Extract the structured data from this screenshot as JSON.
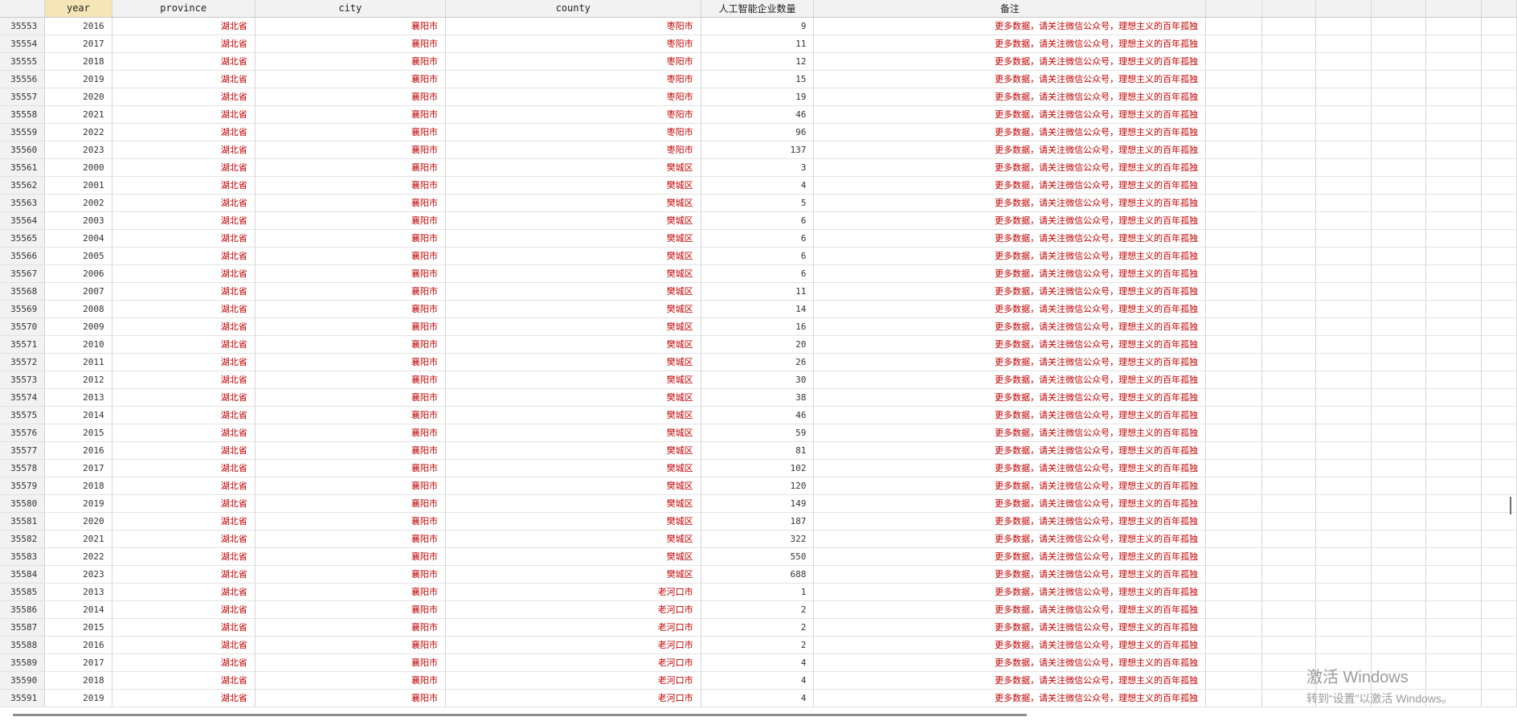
{
  "columns": [
    {
      "key": "rownum",
      "label": ""
    },
    {
      "key": "year",
      "label": "year",
      "selected": true
    },
    {
      "key": "province",
      "label": "province"
    },
    {
      "key": "city",
      "label": "city"
    },
    {
      "key": "county",
      "label": "county"
    },
    {
      "key": "ai_count",
      "label": "人工智能企业数量"
    },
    {
      "key": "note",
      "label": "备注"
    },
    {
      "key": "e1",
      "label": ""
    },
    {
      "key": "e2",
      "label": ""
    },
    {
      "key": "e3",
      "label": ""
    },
    {
      "key": "e4",
      "label": ""
    },
    {
      "key": "e5",
      "label": ""
    },
    {
      "key": "e6",
      "label": ""
    }
  ],
  "rows": [
    {
      "rownum": "35553",
      "year": "2016",
      "province": "湖北省",
      "city": "襄阳市",
      "county": "枣阳市",
      "ai_count": "9",
      "note": "更多数据，请关注微信公众号，理想主义的百年孤独"
    },
    {
      "rownum": "35554",
      "year": "2017",
      "province": "湖北省",
      "city": "襄阳市",
      "county": "枣阳市",
      "ai_count": "11",
      "note": "更多数据，请关注微信公众号，理想主义的百年孤独"
    },
    {
      "rownum": "35555",
      "year": "2018",
      "province": "湖北省",
      "city": "襄阳市",
      "county": "枣阳市",
      "ai_count": "12",
      "note": "更多数据，请关注微信公众号，理想主义的百年孤独"
    },
    {
      "rownum": "35556",
      "year": "2019",
      "province": "湖北省",
      "city": "襄阳市",
      "county": "枣阳市",
      "ai_count": "15",
      "note": "更多数据，请关注微信公众号，理想主义的百年孤独"
    },
    {
      "rownum": "35557",
      "year": "2020",
      "province": "湖北省",
      "city": "襄阳市",
      "county": "枣阳市",
      "ai_count": "19",
      "note": "更多数据，请关注微信公众号，理想主义的百年孤独"
    },
    {
      "rownum": "35558",
      "year": "2021",
      "province": "湖北省",
      "city": "襄阳市",
      "county": "枣阳市",
      "ai_count": "46",
      "note": "更多数据，请关注微信公众号，理想主义的百年孤独"
    },
    {
      "rownum": "35559",
      "year": "2022",
      "province": "湖北省",
      "city": "襄阳市",
      "county": "枣阳市",
      "ai_count": "96",
      "note": "更多数据，请关注微信公众号，理想主义的百年孤独"
    },
    {
      "rownum": "35560",
      "year": "2023",
      "province": "湖北省",
      "city": "襄阳市",
      "county": "枣阳市",
      "ai_count": "137",
      "note": "更多数据，请关注微信公众号，理想主义的百年孤独"
    },
    {
      "rownum": "35561",
      "year": "2000",
      "province": "湖北省",
      "city": "襄阳市",
      "county": "樊城区",
      "ai_count": "3",
      "note": "更多数据，请关注微信公众号，理想主义的百年孤独"
    },
    {
      "rownum": "35562",
      "year": "2001",
      "province": "湖北省",
      "city": "襄阳市",
      "county": "樊城区",
      "ai_count": "4",
      "note": "更多数据，请关注微信公众号，理想主义的百年孤独"
    },
    {
      "rownum": "35563",
      "year": "2002",
      "province": "湖北省",
      "city": "襄阳市",
      "county": "樊城区",
      "ai_count": "5",
      "note": "更多数据，请关注微信公众号，理想主义的百年孤独"
    },
    {
      "rownum": "35564",
      "year": "2003",
      "province": "湖北省",
      "city": "襄阳市",
      "county": "樊城区",
      "ai_count": "6",
      "note": "更多数据，请关注微信公众号，理想主义的百年孤独"
    },
    {
      "rownum": "35565",
      "year": "2004",
      "province": "湖北省",
      "city": "襄阳市",
      "county": "樊城区",
      "ai_count": "6",
      "note": "更多数据，请关注微信公众号，理想主义的百年孤独"
    },
    {
      "rownum": "35566",
      "year": "2005",
      "province": "湖北省",
      "city": "襄阳市",
      "county": "樊城区",
      "ai_count": "6",
      "note": "更多数据，请关注微信公众号，理想主义的百年孤独"
    },
    {
      "rownum": "35567",
      "year": "2006",
      "province": "湖北省",
      "city": "襄阳市",
      "county": "樊城区",
      "ai_count": "6",
      "note": "更多数据，请关注微信公众号，理想主义的百年孤独"
    },
    {
      "rownum": "35568",
      "year": "2007",
      "province": "湖北省",
      "city": "襄阳市",
      "county": "樊城区",
      "ai_count": "11",
      "note": "更多数据，请关注微信公众号，理想主义的百年孤独"
    },
    {
      "rownum": "35569",
      "year": "2008",
      "province": "湖北省",
      "city": "襄阳市",
      "county": "樊城区",
      "ai_count": "14",
      "note": "更多数据，请关注微信公众号，理想主义的百年孤独"
    },
    {
      "rownum": "35570",
      "year": "2009",
      "province": "湖北省",
      "city": "襄阳市",
      "county": "樊城区",
      "ai_count": "16",
      "note": "更多数据，请关注微信公众号，理想主义的百年孤独"
    },
    {
      "rownum": "35571",
      "year": "2010",
      "province": "湖北省",
      "city": "襄阳市",
      "county": "樊城区",
      "ai_count": "20",
      "note": "更多数据，请关注微信公众号，理想主义的百年孤独"
    },
    {
      "rownum": "35572",
      "year": "2011",
      "province": "湖北省",
      "city": "襄阳市",
      "county": "樊城区",
      "ai_count": "26",
      "note": "更多数据，请关注微信公众号，理想主义的百年孤独"
    },
    {
      "rownum": "35573",
      "year": "2012",
      "province": "湖北省",
      "city": "襄阳市",
      "county": "樊城区",
      "ai_count": "30",
      "note": "更多数据，请关注微信公众号，理想主义的百年孤独"
    },
    {
      "rownum": "35574",
      "year": "2013",
      "province": "湖北省",
      "city": "襄阳市",
      "county": "樊城区",
      "ai_count": "38",
      "note": "更多数据，请关注微信公众号，理想主义的百年孤独"
    },
    {
      "rownum": "35575",
      "year": "2014",
      "province": "湖北省",
      "city": "襄阳市",
      "county": "樊城区",
      "ai_count": "46",
      "note": "更多数据，请关注微信公众号，理想主义的百年孤独"
    },
    {
      "rownum": "35576",
      "year": "2015",
      "province": "湖北省",
      "city": "襄阳市",
      "county": "樊城区",
      "ai_count": "59",
      "note": "更多数据，请关注微信公众号，理想主义的百年孤独"
    },
    {
      "rownum": "35577",
      "year": "2016",
      "province": "湖北省",
      "city": "襄阳市",
      "county": "樊城区",
      "ai_count": "81",
      "note": "更多数据，请关注微信公众号，理想主义的百年孤独"
    },
    {
      "rownum": "35578",
      "year": "2017",
      "province": "湖北省",
      "city": "襄阳市",
      "county": "樊城区",
      "ai_count": "102",
      "note": "更多数据，请关注微信公众号，理想主义的百年孤独"
    },
    {
      "rownum": "35579",
      "year": "2018",
      "province": "湖北省",
      "city": "襄阳市",
      "county": "樊城区",
      "ai_count": "120",
      "note": "更多数据，请关注微信公众号，理想主义的百年孤独"
    },
    {
      "rownum": "35580",
      "year": "2019",
      "province": "湖北省",
      "city": "襄阳市",
      "county": "樊城区",
      "ai_count": "149",
      "note": "更多数据，请关注微信公众号，理想主义的百年孤独"
    },
    {
      "rownum": "35581",
      "year": "2020",
      "province": "湖北省",
      "city": "襄阳市",
      "county": "樊城区",
      "ai_count": "187",
      "note": "更多数据，请关注微信公众号，理想主义的百年孤独"
    },
    {
      "rownum": "35582",
      "year": "2021",
      "province": "湖北省",
      "city": "襄阳市",
      "county": "樊城区",
      "ai_count": "322",
      "note": "更多数据，请关注微信公众号，理想主义的百年孤独"
    },
    {
      "rownum": "35583",
      "year": "2022",
      "province": "湖北省",
      "city": "襄阳市",
      "county": "樊城区",
      "ai_count": "550",
      "note": "更多数据，请关注微信公众号，理想主义的百年孤独"
    },
    {
      "rownum": "35584",
      "year": "2023",
      "province": "湖北省",
      "city": "襄阳市",
      "county": "樊城区",
      "ai_count": "688",
      "note": "更多数据，请关注微信公众号，理想主义的百年孤独"
    },
    {
      "rownum": "35585",
      "year": "2013",
      "province": "湖北省",
      "city": "襄阳市",
      "county": "老河口市",
      "ai_count": "1",
      "note": "更多数据，请关注微信公众号，理想主义的百年孤独"
    },
    {
      "rownum": "35586",
      "year": "2014",
      "province": "湖北省",
      "city": "襄阳市",
      "county": "老河口市",
      "ai_count": "2",
      "note": "更多数据，请关注微信公众号，理想主义的百年孤独"
    },
    {
      "rownum": "35587",
      "year": "2015",
      "province": "湖北省",
      "city": "襄阳市",
      "county": "老河口市",
      "ai_count": "2",
      "note": "更多数据，请关注微信公众号，理想主义的百年孤独"
    },
    {
      "rownum": "35588",
      "year": "2016",
      "province": "湖北省",
      "city": "襄阳市",
      "county": "老河口市",
      "ai_count": "2",
      "note": "更多数据，请关注微信公众号，理想主义的百年孤独"
    },
    {
      "rownum": "35589",
      "year": "2017",
      "province": "湖北省",
      "city": "襄阳市",
      "county": "老河口市",
      "ai_count": "4",
      "note": "更多数据，请关注微信公众号，理想主义的百年孤独"
    },
    {
      "rownum": "35590",
      "year": "2018",
      "province": "湖北省",
      "city": "襄阳市",
      "county": "老河口市",
      "ai_count": "4",
      "note": "更多数据，请关注微信公众号，理想主义的百年孤独"
    },
    {
      "rownum": "35591",
      "year": "2019",
      "province": "湖北省",
      "city": "襄阳市",
      "county": "老河口市",
      "ai_count": "4",
      "note": "更多数据，请关注微信公众号，理想主义的百年孤独"
    }
  ],
  "watermark": {
    "line1": "激活 Windows",
    "line2": "转到“设置”以激活 Windows。"
  }
}
